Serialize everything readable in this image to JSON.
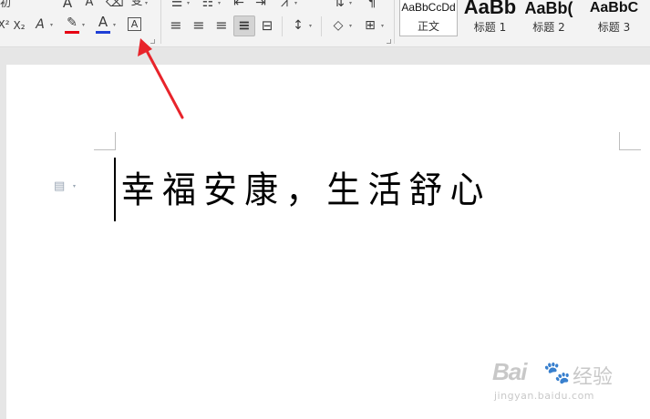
{
  "ribbon": {
    "font_group": {
      "partial_label": "初",
      "grow_font": "A",
      "shrink_font": "A",
      "clear_format": "⌫",
      "phonetic_guide": "变",
      "superscript": "X²",
      "subscript": "X₂",
      "text_effect": "A",
      "highlight": "✎",
      "font_color": "A",
      "char_border": "A"
    },
    "paragraph_group": {
      "bullets": "☰",
      "numbering": "☷",
      "decrease_indent": "⇤",
      "increase_indent": "⇥",
      "chinese_layout": "⩘",
      "sort": "⇅",
      "align_left": "≡",
      "align_center": "≡",
      "align_right": "≡",
      "justify": "≡",
      "distributed": "⊟",
      "line_spacing": "↕",
      "shading": "◇",
      "borders": "⊞"
    },
    "styles": [
      {
        "sample": "AaBbCcDd",
        "name": "正文",
        "selected": true
      },
      {
        "sample": "AaBb",
        "name": "标题 1"
      },
      {
        "sample": "AaBb(",
        "name": "标题 2"
      },
      {
        "sample": "AaBbC",
        "name": "标题 3"
      }
    ]
  },
  "document": {
    "text": "幸福安康，生活舒心",
    "paragraph_marker_icon": "paragraph-icon"
  },
  "colors": {
    "highlight_bar": "#e60012",
    "font_color_bar": "#1e3fd6",
    "arrow": "#e8242b"
  },
  "watermark": {
    "brand": "Bai",
    "paw": "🐾",
    "title": "经验",
    "domain": "jingyan.baidu.com"
  }
}
